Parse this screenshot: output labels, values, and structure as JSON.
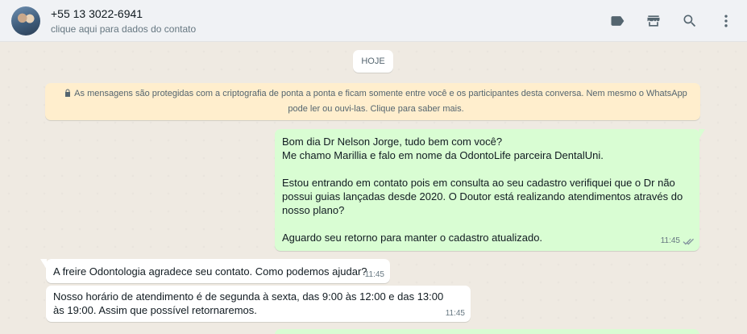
{
  "header": {
    "contact_name": "+55 13 3022-6941",
    "contact_subtitle": "clique aqui para dados do contato",
    "icons": [
      "label-icon",
      "shop-icon",
      "search-icon",
      "menu-icon"
    ]
  },
  "chat": {
    "date_chip": "HOJE",
    "encryption_notice": "As mensagens são protegidas com a criptografia de ponta a ponta e ficam somente entre você e os participantes desta conversa. Nem mesmo o WhatsApp pode ler ou ouvi-las. Clique para saber mais.",
    "messages": [
      {
        "direction": "out",
        "text": "Bom dia Dr Nelson Jorge, tudo bem com você?\nMe chamo Marillia e falo em nome da OdontoLife parceira DentalUni.\n\nEstou entrando em contato pois em consulta ao seu cadastro verifiquei que o Dr não possui guias lançadas desde 2020. O Doutor está realizando atendimentos através do nosso plano?\n\nAguardo seu retorno para manter o cadastro atualizado.",
        "time": "11:45",
        "status": "read"
      },
      {
        "direction": "in",
        "text": "A freire Odontologia agradece seu contato. Como podemos ajudar?",
        "time": "11:45"
      },
      {
        "direction": "in",
        "text": "Nosso horário de atendimento é de segunda à sexta, das 9:00 às 12:00 e das 13:00 às 19:00. Assim que possível retornaremos.",
        "time": "11:45"
      }
    ]
  },
  "colors": {
    "chat_bg": "#efeae2",
    "outgoing_bubble": "#d9fdd3",
    "incoming_bubble": "#ffffff",
    "notice_bg": "#ffeecd",
    "header_bg": "#f0f2f5"
  }
}
